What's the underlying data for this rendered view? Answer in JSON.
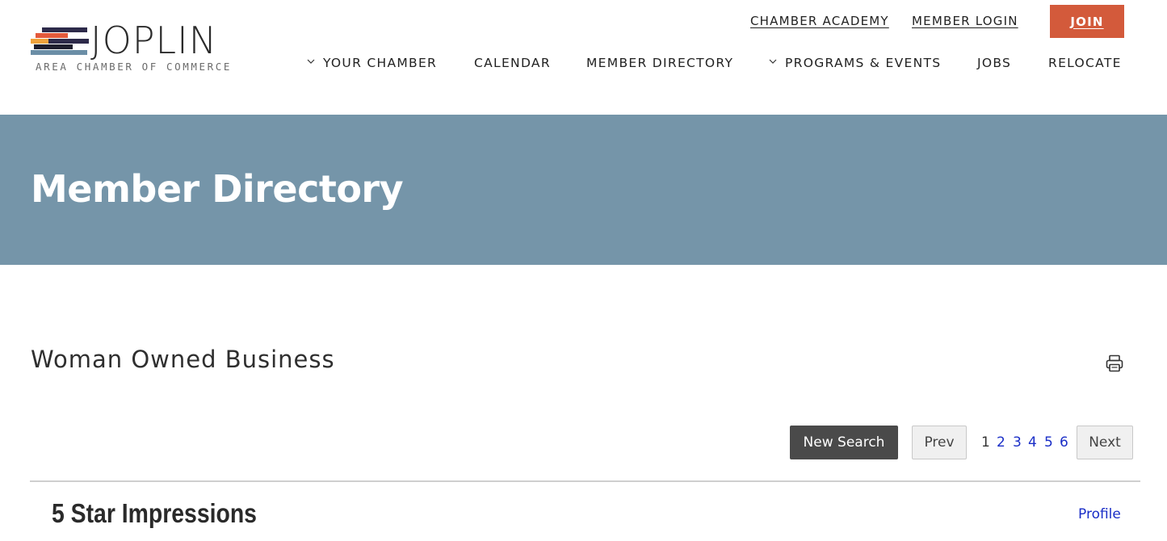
{
  "brand": {
    "wordmark": "JOPLIN",
    "subtitle": "AREA CHAMBER OF COMMERCE",
    "stripe_colors": [
      "#2d2a4a",
      "#e45a3c",
      "#f0a23b",
      "#6b8ea6",
      "#1f1f2e"
    ]
  },
  "utility_nav": {
    "academy": "CHAMBER ACADEMY",
    "login": "MEMBER LOGIN",
    "join": "JOIN"
  },
  "main_nav": {
    "items": [
      {
        "label": "YOUR CHAMBER",
        "has_dropdown": true,
        "icon": "chevron-down-icon"
      },
      {
        "label": "CALENDAR",
        "has_dropdown": false
      },
      {
        "label": "MEMBER DIRECTORY",
        "has_dropdown": false
      },
      {
        "label": "PROGRAMS & EVENTS",
        "has_dropdown": true,
        "icon": "chevron-down-icon"
      },
      {
        "label": "JOBS",
        "has_dropdown": false
      },
      {
        "label": "RELOCATE",
        "has_dropdown": false
      }
    ]
  },
  "hero": {
    "title": "Member Directory",
    "background": "#7595a9"
  },
  "directory": {
    "category": "Woman Owned Business",
    "print_icon": "printer-icon",
    "new_search": "New Search",
    "prev": "Prev",
    "next": "Next",
    "pages": [
      "1",
      "2",
      "3",
      "4",
      "5",
      "6"
    ],
    "current_page": "1",
    "listings": [
      {
        "name": "5 Star Impressions",
        "profile_label": "Profile"
      }
    ]
  },
  "colors": {
    "accent_join": "#d35a3b",
    "link": "#1a2ec7",
    "button_dark": "#4a4a4a"
  }
}
